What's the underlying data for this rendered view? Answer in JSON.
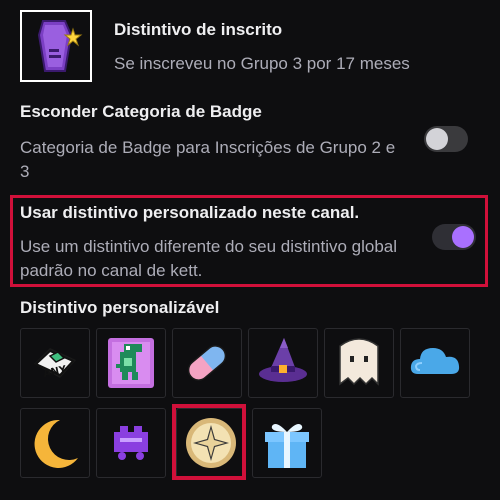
{
  "header": {
    "badge_icon": "purple-coffin-star-icon",
    "title": "Distintivo de inscrito",
    "subtitle": "Se inscreveu no Grupo 3 por 17 meses"
  },
  "hide_category": {
    "title": "Esconder Categoria de Badge",
    "description": "Categoria de Badge para Inscrições de Grupo 2 e 3",
    "toggle_on": false
  },
  "custom_badge": {
    "title": "Usar distintivo personalizado neste canal.",
    "description": "Use um distintivo diferente do seu distintivo global padrão no canal de kett.",
    "toggle_on": true
  },
  "grid": {
    "title": "Distintivo personalizável",
    "badges": [
      {
        "icon": "any-key-icon",
        "text": "ANY"
      },
      {
        "icon": "pixel-dino-icon"
      },
      {
        "icon": "pill-capsule-icon"
      },
      {
        "icon": "witch-hat-icon"
      },
      {
        "icon": "ghost-icon"
      },
      {
        "icon": "cloud-icon"
      },
      {
        "icon": "crescent-moon-icon"
      },
      {
        "icon": "purple-cart-icon"
      },
      {
        "icon": "gold-star-coin-icon",
        "selected": true
      },
      {
        "icon": "gift-box-icon"
      }
    ]
  },
  "colors": {
    "accent": "#a970ff",
    "highlight": "#d0103a",
    "background": "#0e0e10"
  }
}
